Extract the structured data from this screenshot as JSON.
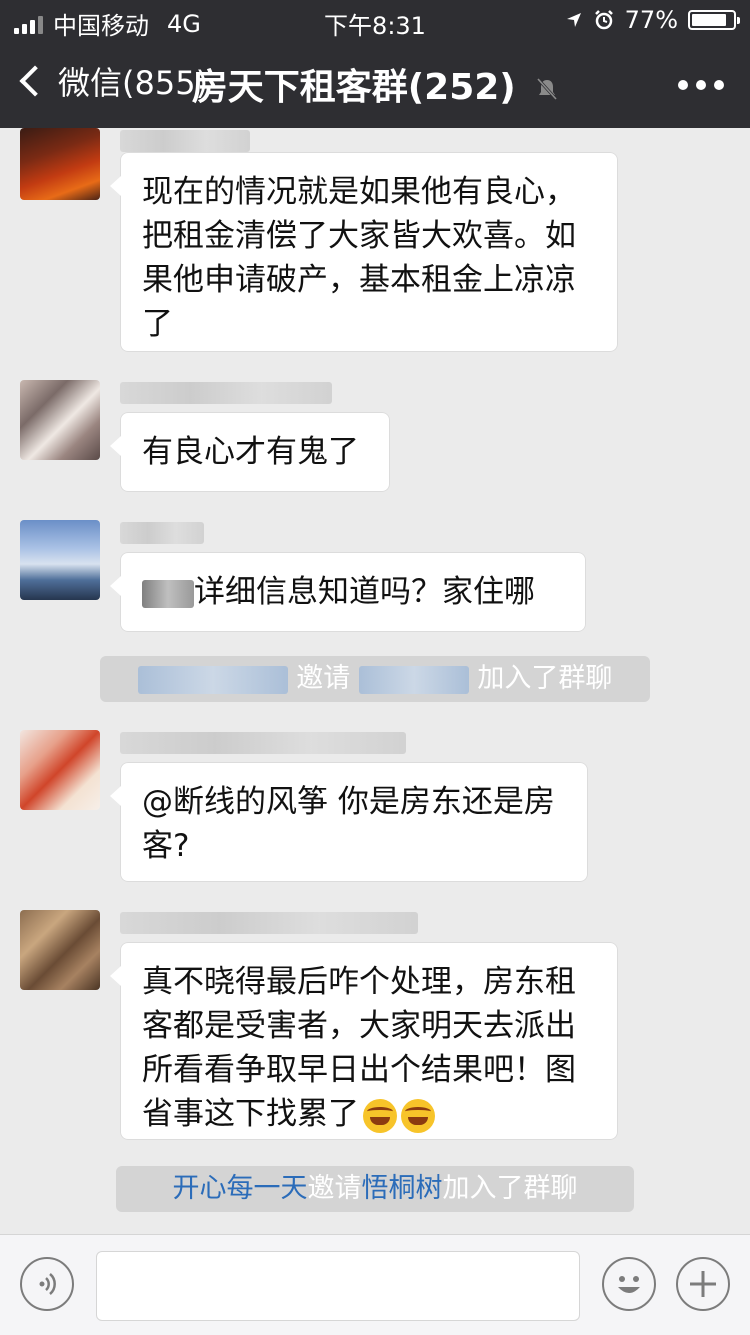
{
  "status": {
    "carrier": "中国移动",
    "network": "4G",
    "time": "下午8:31",
    "battery": "77%"
  },
  "nav": {
    "back_label": "微信(855)",
    "title": "房天下租客群(252)"
  },
  "messages": [
    {
      "text": "现在的情况就是如果他有良心，\n把租金清偿了大家皆大欢喜。如\n果他申请破产，基本租金上凉凉\n了"
    },
    {
      "text": "有良心才有鬼了"
    },
    {
      "text": "详细信息知道吗？家住哪"
    },
    {
      "text": "@断线的风筝 你是房东还是房\n客?"
    },
    {
      "text": "真不晓得最后咋个处理，房东租\n客都是受害者，大家明天去派出\n所看看争取早日出个结果吧！图\n省事这下找累了"
    }
  ],
  "system_notices": [
    {
      "invite": "邀请",
      "joined": "加入了群聊"
    },
    {
      "inviter": "开心每一天",
      "invite": "邀请",
      "invitee": "悟桐树",
      "joined": "加入了群聊"
    }
  ],
  "icons": {
    "voice": "voice-icon",
    "emoji": "emoji-icon",
    "plus": "plus-icon"
  },
  "colors": {
    "navbar": "#2e2e32",
    "background": "#ebebeb",
    "link": "#2b6cb9"
  }
}
